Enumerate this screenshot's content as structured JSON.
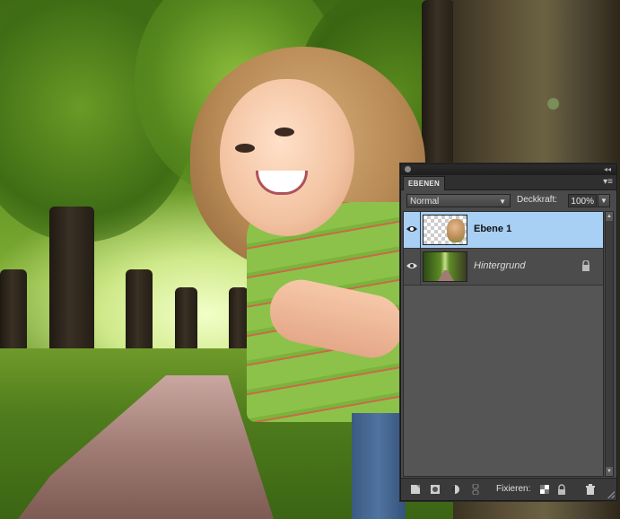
{
  "panel": {
    "tab_label": "EBENEN",
    "blend_mode": "Normal",
    "opacity_label": "Deckkraft:",
    "opacity_value": "100%",
    "fix_label": "Fixieren:",
    "layers": [
      {
        "name": "Ebene 1",
        "selected": true,
        "visible": true,
        "locked": false,
        "thumbnail": "transparent-cutout"
      },
      {
        "name": "Hintergrund",
        "selected": false,
        "visible": true,
        "locked": true,
        "thumbnail": "forest-path"
      }
    ],
    "footer_icons": [
      "new-layer-icon",
      "mask-icon",
      "adjustment-layer-icon",
      "link-icon",
      "lock-transparent-icon",
      "lock-all-icon",
      "trash-icon"
    ]
  },
  "colors": {
    "selected_layer": "#a8cff4",
    "panel_bg": "#4a4a4a"
  }
}
